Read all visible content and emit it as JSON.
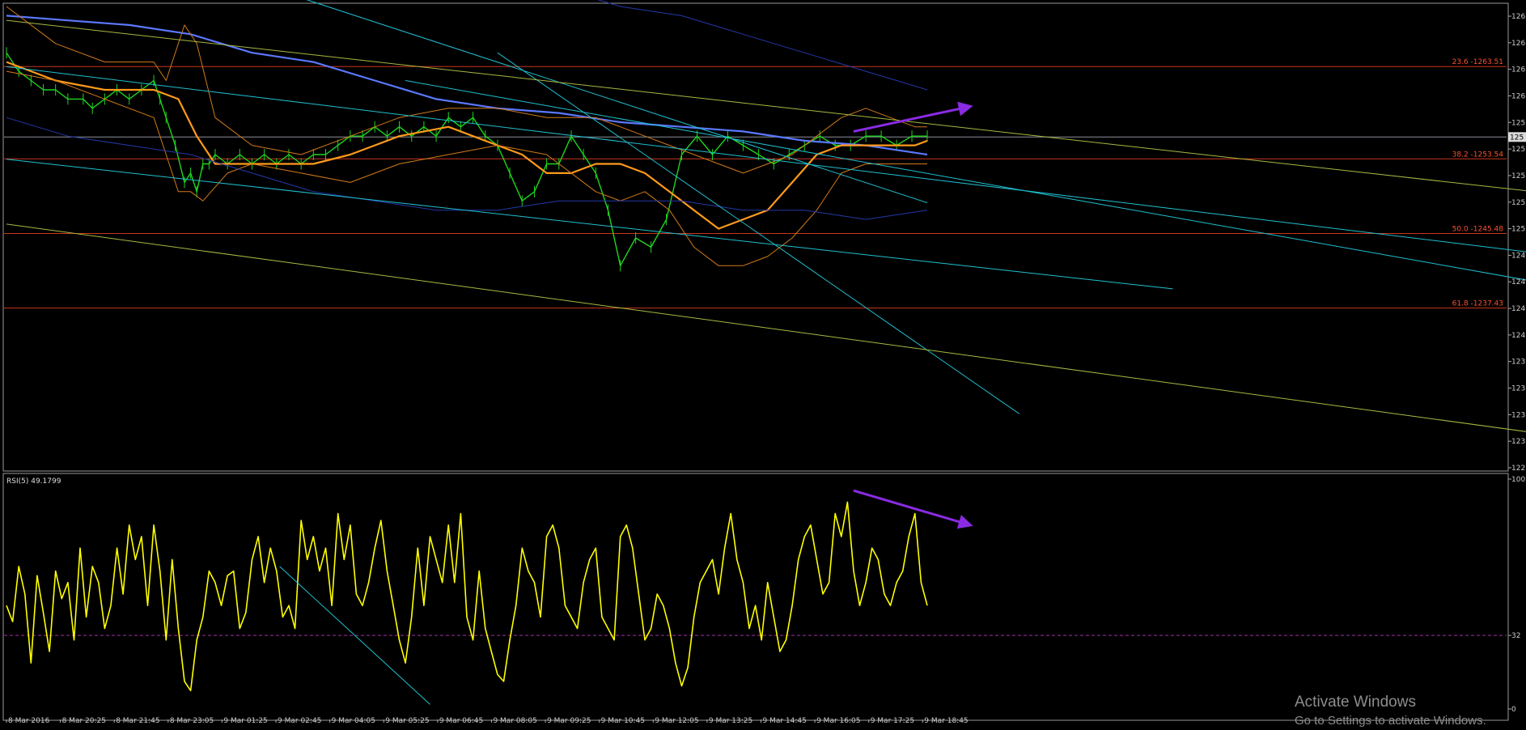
{
  "chart_data": [
    {
      "type": "line",
      "panel": "price",
      "ylim": [
        1220,
        1270
      ],
      "y_ticks": [
        "126",
        "126",
        "126",
        "126",
        "125",
        "125",
        "125",
        "125",
        "125",
        "124",
        "124",
        "124",
        "124",
        "123",
        "123",
        "123",
        "123",
        "122"
      ],
      "current_price_label": "125",
      "x_ticks": [
        "8 Mar 2016",
        "8 Mar 20:25",
        "8 Mar 21:45",
        "8 Mar 23:05",
        "9 Mar 01:25",
        "9 Mar 02:45",
        "9 Mar 04:05",
        "9 Mar 05:25",
        "9 Mar 06:45",
        "9 Mar 08:05",
        "9 Mar 09:25",
        "9 Mar 10:45",
        "9 Mar 12:05",
        "9 Mar 13:25",
        "9 Mar 14:45",
        "9 Mar 16:05",
        "9 Mar 17:25",
        "9 Mar 18:45"
      ],
      "fibonacci_levels": [
        {
          "label": "23.6 -1263.51",
          "value": 1263.51
        },
        {
          "label": "38.2 -1253.54",
          "value": 1253.54
        },
        {
          "label": "50.0 -1245.48",
          "value": 1245.48
        },
        {
          "label": "61.8 -1237.43",
          "value": 1237.43
        }
      ],
      "current_price": 1255.9,
      "series": [
        {
          "role": "price",
          "x": [
            0,
            4,
            8,
            12,
            16,
            20,
            25,
            28,
            32,
            36,
            40,
            44,
            48,
            50,
            52,
            55,
            58,
            60,
            62,
            64,
            66,
            68,
            72,
            76,
            80,
            84,
            88,
            92,
            96,
            100,
            104,
            108,
            112,
            116,
            120,
            124,
            128,
            132,
            136,
            140,
            144,
            148,
            152,
            156,
            160,
            164,
            168,
            172,
            176,
            180,
            184,
            188,
            192,
            196,
            200,
            205,
            210,
            215,
            220,
            225,
            230,
            235,
            240,
            245,
            250,
            255,
            260,
            265,
            270,
            275,
            280,
            285,
            290,
            295,
            300
          ],
          "y": [
            1265,
            1263,
            1262,
            1261,
            1261,
            1260,
            1260,
            1259,
            1260,
            1261,
            1260,
            1261,
            1262,
            1260,
            1258,
            1255,
            1251,
            1252,
            1250,
            1253,
            1253,
            1254,
            1253,
            1254,
            1253,
            1254,
            1253,
            1254,
            1253,
            1254,
            1254,
            1255,
            1256,
            1256,
            1257,
            1256,
            1257,
            1256,
            1257,
            1256,
            1258,
            1257,
            1258,
            1256,
            1255,
            1252,
            1249,
            1250,
            1253,
            1253,
            1256,
            1254,
            1252,
            1248,
            1242,
            1245,
            1244,
            1247,
            1254,
            1256,
            1254,
            1256,
            1255,
            1254,
            1253,
            1254,
            1255,
            1256,
            1255,
            1255,
            1256,
            1256,
            1255,
            1256,
            1256
          ]
        },
        {
          "role": "ma-blue-slow",
          "x": [
            0,
            20,
            40,
            60,
            80,
            100,
            120,
            140,
            160,
            180,
            200,
            220,
            240,
            260,
            280,
            300
          ],
          "y": [
            1269,
            1268.5,
            1268,
            1267,
            1265,
            1264,
            1262,
            1260,
            1259,
            1258.5,
            1257.5,
            1257,
            1256.5,
            1255.5,
            1255,
            1254
          ]
        },
        {
          "role": "ma-orange",
          "x": [
            0,
            16,
            32,
            48,
            56,
            62,
            68,
            80,
            92,
            100,
            112,
            120,
            128,
            136,
            144,
            152,
            160,
            168,
            176,
            184,
            192,
            200,
            208,
            216,
            224,
            232,
            240,
            248,
            256,
            264,
            272,
            280,
            288,
            296,
            300
          ],
          "y": [
            1264,
            1262,
            1261,
            1261,
            1260,
            1256,
            1253,
            1253,
            1253,
            1253,
            1254,
            1255,
            1256,
            1256.5,
            1257,
            1256,
            1255,
            1254,
            1252,
            1252,
            1253,
            1253,
            1252,
            1250,
            1248,
            1246,
            1247,
            1248,
            1251,
            1254,
            1255,
            1255,
            1255,
            1255,
            1255.5
          ]
        },
        {
          "role": "bb-upper",
          "x": [
            0,
            16,
            32,
            48,
            52,
            58,
            62,
            68,
            80,
            96,
            112,
            128,
            144,
            160,
            176,
            192,
            200,
            208,
            216,
            224,
            232,
            240,
            248,
            256,
            264,
            272,
            280,
            288,
            296,
            300
          ],
          "y": [
            1270,
            1266,
            1264,
            1264,
            1262,
            1268,
            1266,
            1258,
            1255,
            1254,
            1256,
            1258,
            1259,
            1259,
            1258,
            1258,
            1257,
            1256,
            1255,
            1254,
            1253,
            1252,
            1253,
            1254,
            1256,
            1258,
            1259,
            1258,
            1257,
            1257
          ]
        },
        {
          "role": "bb-lower",
          "x": [
            0,
            16,
            32,
            48,
            52,
            56,
            60,
            64,
            72,
            80,
            96,
            112,
            128,
            144,
            160,
            176,
            192,
            200,
            208,
            216,
            224,
            232,
            240,
            248,
            256,
            264,
            272,
            280,
            288,
            296,
            300
          ],
          "y": [
            1263,
            1262,
            1260,
            1258,
            1254,
            1250,
            1250,
            1249,
            1252,
            1253,
            1252,
            1251,
            1253,
            1254,
            1255,
            1254,
            1250,
            1249,
            1250,
            1248,
            1244,
            1242,
            1242,
            1243,
            1245,
            1248,
            1252,
            1253,
            1253,
            1253,
            1253
          ]
        },
        {
          "role": "envelope-upper",
          "x": [
            160,
            170,
            180,
            190,
            200,
            210,
            220,
            230,
            240,
            250,
            260,
            270,
            280,
            290,
            300
          ],
          "y": [
            1275,
            1273,
            1272,
            1271,
            1270,
            1269.5,
            1269,
            1268,
            1267,
            1266,
            1265,
            1264,
            1263,
            1262,
            1261
          ]
        },
        {
          "role": "envelope-lower",
          "x": [
            0,
            20,
            40,
            60,
            80,
            100,
            120,
            140,
            160,
            180,
            200,
            220,
            240,
            260,
            280,
            300
          ],
          "y": [
            1258,
            1256,
            1255,
            1254,
            1252,
            1250,
            1249,
            1248,
            1248,
            1249,
            1249,
            1249,
            1248,
            1248,
            1247,
            1248
          ]
        }
      ],
      "trendlines": [
        {
          "color": "#20c0d0",
          "x": [
            0,
            520
          ],
          "y": [
            1263.5,
            1242.5
          ]
        },
        {
          "color": "#20c0d0",
          "x": [
            0,
            380
          ],
          "y": [
            1253.5,
            1239.5
          ]
        },
        {
          "color": "#20c0d0",
          "x": [
            40,
            300
          ],
          "y": [
            1277,
            1248.8
          ]
        },
        {
          "color": "#20c0d0",
          "x": [
            130,
            630
          ],
          "y": [
            1262,
            1232.5
          ]
        },
        {
          "color": "#20c0d0",
          "x": [
            160,
            330
          ],
          "y": [
            1265,
            1226
          ]
        },
        {
          "color": "#a8b840",
          "x": [
            0,
            530
          ],
          "y": [
            1268.5,
            1248.8
          ]
        },
        {
          "color": "#a8b840",
          "x": [
            0,
            530
          ],
          "y": [
            1246.5,
            1222.5
          ]
        }
      ],
      "divergence_arrow": {
        "color": "#8a2be2",
        "x": [
          276,
          314
        ],
        "y": [
          1256.5,
          1259.2
        ]
      }
    },
    {
      "type": "line",
      "panel": "rsi",
      "label": "RSI(5) 49.1799",
      "ylim": [
        0,
        100
      ],
      "y_ticks": [
        "100",
        "32",
        "0"
      ],
      "dashed_level": 32,
      "series": [
        {
          "role": "rsi",
          "x": [
            0,
            2,
            4,
            6,
            8,
            10,
            12,
            14,
            16,
            18,
            20,
            22,
            24,
            26,
            28,
            30,
            32,
            34,
            36,
            38,
            40,
            42,
            44,
            46,
            48,
            50,
            52,
            54,
            56,
            58,
            60,
            62,
            64,
            66,
            68,
            70,
            72,
            74,
            76,
            78,
            80,
            82,
            84,
            86,
            88,
            90,
            92,
            94,
            96,
            98,
            100,
            102,
            104,
            106,
            108,
            110,
            112,
            114,
            116,
            118,
            120,
            122,
            124,
            126,
            128,
            130,
            132,
            134,
            136,
            138,
            140,
            142,
            144,
            146,
            148,
            150,
            152,
            154,
            156,
            158,
            160,
            162,
            164,
            166,
            168,
            170,
            172,
            174,
            176,
            178,
            180,
            182,
            184,
            186,
            188,
            190,
            192,
            194,
            196,
            198,
            200,
            202,
            204,
            206,
            208,
            210,
            212,
            214,
            216,
            218,
            220,
            222,
            224,
            226,
            228,
            230,
            232,
            234,
            236,
            238,
            240,
            242,
            244,
            246,
            248,
            250,
            252,
            254,
            256,
            258,
            260,
            262,
            264,
            266,
            268,
            270,
            272,
            274,
            276,
            278,
            280,
            282,
            284,
            286,
            288,
            290,
            292,
            294,
            296,
            298,
            300
          ],
          "y": [
            45,
            38,
            62,
            50,
            20,
            58,
            42,
            25,
            60,
            48,
            55,
            30,
            70,
            40,
            62,
            55,
            35,
            45,
            70,
            50,
            80,
            65,
            75,
            45,
            80,
            60,
            30,
            65,
            35,
            12,
            8,
            30,
            40,
            60,
            55,
            45,
            58,
            60,
            35,
            42,
            65,
            75,
            55,
            70,
            60,
            40,
            45,
            35,
            82,
            65,
            75,
            60,
            70,
            45,
            85,
            65,
            80,
            50,
            45,
            55,
            70,
            82,
            60,
            45,
            30,
            20,
            40,
            70,
            45,
            75,
            65,
            55,
            80,
            55,
            85,
            40,
            30,
            60,
            35,
            25,
            15,
            12,
            30,
            45,
            70,
            60,
            55,
            40,
            75,
            80,
            70,
            45,
            40,
            35,
            55,
            65,
            70,
            40,
            35,
            30,
            75,
            80,
            70,
            50,
            30,
            35,
            50,
            45,
            35,
            20,
            10,
            18,
            40,
            55,
            60,
            65,
            50,
            70,
            85,
            65,
            55,
            35,
            45,
            30,
            55,
            40,
            25,
            30,
            45,
            65,
            75,
            80,
            65,
            50,
            55,
            85,
            75,
            90,
            60,
            45,
            55,
            70,
            65,
            50,
            45,
            55,
            60,
            75,
            85,
            55,
            45
          ]
        }
      ],
      "trendlines": [
        {
          "color": "#20c0d0",
          "x": [
            89,
            138
          ],
          "y": [
            62,
            2
          ]
        }
      ],
      "divergence_arrow": {
        "color": "#8a2be2",
        "x": [
          276,
          314
        ],
        "y": [
          95,
          80
        ]
      }
    }
  ],
  "watermark": {
    "line1": "Activate Windows",
    "line2": "Go to Settings to activate Windows."
  }
}
